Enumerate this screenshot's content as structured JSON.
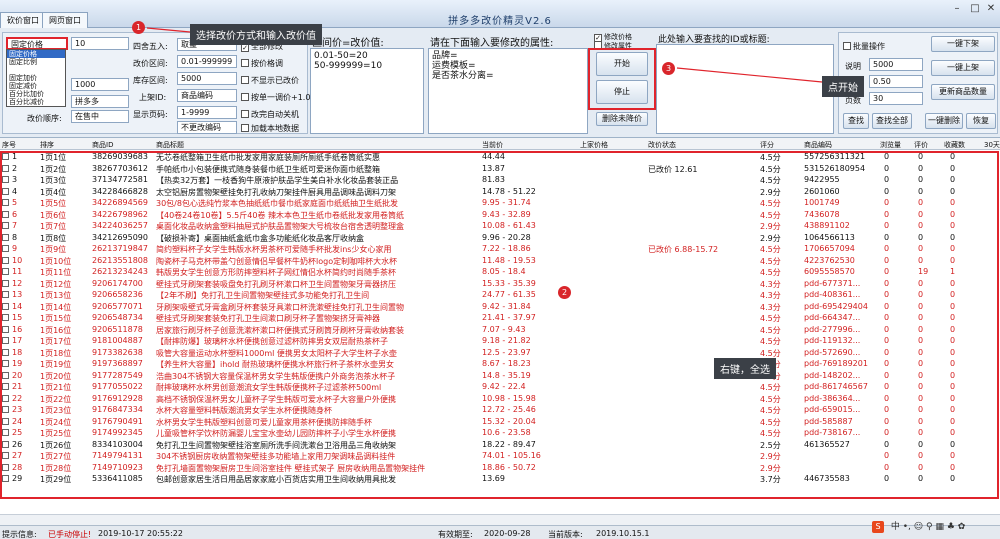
{
  "window": {
    "tabs": [
      "砍价窗口",
      "网页窗口"
    ],
    "title": "拼多多改价精灵V2.6"
  },
  "left_panel": {
    "mode_select": "固定价格",
    "mode_value": "10",
    "dropdown_options": [
      "固定价格",
      "固定比例",
      "",
      "固定加价",
      "固定减价",
      "百分比加价",
      "百分比减价"
    ],
    "labels": {
      "round": "四舍五入:",
      "range": "改价区间:",
      "stock": "库存区间:",
      "category": "上架ID:",
      "display": "显示页码:",
      "sort": "改价顺序:"
    },
    "values": {
      "round": "取整",
      "range": "0.01-999999",
      "stock": "5000",
      "category": "商品编码",
      "display": "1-9999",
      "display2": "不更改编码",
      "v_a": "1000",
      "v_b": "拼多多",
      "v_c": "在售中"
    },
    "checks": {
      "c1": "全部修改",
      "c2": "按价格调",
      "c3": "不显示已改价",
      "c4": "按单一调价+1.01",
      "c5": "改完自动关机",
      "c6": "加载本地数据"
    }
  },
  "price_box": {
    "label": "区间价=改价值:",
    "content": "0.01-50=20\n50-999999=10"
  },
  "attr_box": {
    "label": "请在下面输入要修改的属性:",
    "content": "品牌=\n运费模板=\n是否茶水分离="
  },
  "actions": {
    "modify_price": "修改价格",
    "modify_attr": "修改属性",
    "start": "开始",
    "stop": "停止",
    "clear": "删除未降价"
  },
  "search_box": {
    "label": "此处输入要查找的ID或标题:"
  },
  "right_panel": {
    "batch": "批量操作",
    "btn_download": "一键下架",
    "btn_upload": "一键上架",
    "btn_update": "更新商品数量",
    "btn_delete": "一键删除",
    "btn_find": "查找",
    "btn_findall": "查找全部",
    "btn_restore": "恢复",
    "tip_label": "说明",
    "tip_value": "5000",
    "tip_label2": "上架",
    "tip_value2": "0.50",
    "tip_label3": "页数",
    "tip_value3": "30"
  },
  "callouts": {
    "c1": "选择改价方式和输入改价值",
    "c2": "右键，全选",
    "c3": "点开始",
    "n1": "1",
    "n2": "2",
    "n3": "3"
  },
  "table": {
    "headers": [
      "序号",
      "排序",
      "商品ID",
      "商品标题",
      "当前价",
      "上家价格",
      "改价状态",
      "评分",
      "商品编码",
      "浏览量",
      "评价",
      "收藏数",
      "30天"
    ],
    "rows": [
      {
        "n": "1",
        "rank": "1页1位",
        "id": "38269039683",
        "title": "无芯卷纸整箱卫生纸巾批发家用家庭装厕所厕纸手纸卷筒纸实惠",
        "price": "44.44",
        "status": "",
        "score": "4.5分",
        "code": "557256311321",
        "views": "0",
        "rev": "0",
        "fav": "0",
        "red": false
      },
      {
        "n": "2",
        "rank": "1页2位",
        "id": "38267703612",
        "title": "手帕纸巾小包装便携式随身装餐巾纸卫生纸可爱迷你面巾纸整箱",
        "price": "13.87",
        "status": "已改价 12.61",
        "score": "4.5分",
        "code": "531526180954",
        "views": "0",
        "rev": "0",
        "fav": "0",
        "red": false
      },
      {
        "n": "3",
        "rank": "1页3位",
        "id": "37134772581",
        "title": "【热卖32万套】一枝香狗牛原液护肤品学生美白补水化妆品套装正品",
        "price": "81.83",
        "status": "",
        "score": "4.5分",
        "code": "9422955",
        "views": "0",
        "rev": "0",
        "fav": "0",
        "red": false
      },
      {
        "n": "4",
        "rank": "1页4位",
        "id": "34228466828",
        "title": "太空铝厨房置物架壁挂免打孔收纳刀架挂件厨具用品调味品调料刀架",
        "price": "14.78 - 51.22",
        "status": "",
        "score": "2.9分",
        "code": "2601060",
        "views": "0",
        "rev": "0",
        "fav": "0",
        "red": false
      },
      {
        "n": "5",
        "rank": "1页5位",
        "id": "34226894569",
        "title": "30包/8包心选纯竹浆本色抽纸纸巾餐巾纸家庭面巾纸纸抽卫生纸批发",
        "price": "9.95 - 31.74",
        "status": "",
        "score": "4.5分",
        "code": "1001749",
        "views": "0",
        "rev": "0",
        "fav": "0",
        "red": true
      },
      {
        "n": "6",
        "rank": "1页6位",
        "id": "34226798962",
        "title": "【40卷24卷10卷】5.5斤40卷 辣木本色卫生纸巾卷纸批发家用卷筒纸",
        "price": "9.43 - 32.89",
        "status": "",
        "score": "4.5分",
        "code": "7436078",
        "views": "0",
        "rev": "0",
        "fav": "0",
        "red": true
      },
      {
        "n": "7",
        "rank": "1页7位",
        "id": "34224036257",
        "title": "桌面化妆品收纳盒塑料抽屉式护肤品置物架大号梳妆台宿舍透明整理盒",
        "price": "10.08 - 61.43",
        "status": "",
        "score": "2.9分",
        "code": "438891102",
        "views": "0",
        "rev": "0",
        "fav": "0",
        "red": true
      },
      {
        "n": "8",
        "rank": "1页8位",
        "id": "34212695090",
        "title": "【破损补寄】桌面抽纸盒纸巾盒多功能纸化妆品客厅收纳盒",
        "price": "9.96 - 20.28",
        "status": "",
        "score": "2.9分",
        "code": "1064566113",
        "views": "0",
        "rev": "0",
        "fav": "0",
        "red": false
      },
      {
        "n": "9",
        "rank": "1页9位",
        "id": "26213719847",
        "title": "简约塑料杯子女学生韩版水杯男茶杯可爱随手杯批发ins少女心家用",
        "price": "7.22 - 18.86",
        "status": "已改价 6.88-15.72",
        "score": "4.5分",
        "code": "1706657094",
        "views": "0",
        "rev": "0",
        "fav": "0",
        "red": true
      },
      {
        "n": "10",
        "rank": "1页10位",
        "id": "26213551808",
        "title": "陶瓷杯子马克杯带盖勺创意情侣早餐杯牛奶杯logo定制咖啡杯大水杯",
        "price": "11.48 - 19.53",
        "status": "",
        "score": "4.5分",
        "code": "4223762530",
        "views": "0",
        "rev": "0",
        "fav": "0",
        "red": true
      },
      {
        "n": "11",
        "rank": "1页11位",
        "id": "26213234243",
        "title": "韩版男女学生创意方形防摔塑料杯子网红情侣水杯简约时尚随手茶杯",
        "price": "8.05 - 18.4",
        "status": "",
        "score": "4.5分",
        "code": "6095558570",
        "views": "0",
        "rev": "19",
        "fav": "1",
        "red": true
      },
      {
        "n": "12",
        "rank": "1页12位",
        "id": "9206174700",
        "title": "壁挂式牙刷架套装吸盘免打孔刷牙杯漱口杯卫生间置物架牙膏器挤压",
        "price": "15.33 - 35.39",
        "status": "",
        "score": "4.3分",
        "code": "pdd-677371...",
        "views": "0",
        "rev": "0",
        "fav": "0",
        "red": true
      },
      {
        "n": "13",
        "rank": "1页13位",
        "id": "9206658236",
        "title": "【2年不刷】免打孔卫生间置物架壁挂式多功能免打孔卫生间",
        "price": "24.77 - 61.35",
        "status": "",
        "score": "4.3分",
        "code": "pdd-408361...",
        "views": "0",
        "rev": "0",
        "fav": "0",
        "red": true
      },
      {
        "n": "14",
        "rank": "1页14位",
        "id": "9206577071",
        "title": "牙刷架吸壁式牙膏盒刷牙杯套装牙具漱口杯洗漱壁挂免打孔卫生间置物",
        "price": "9.42 - 31.84",
        "status": "",
        "score": "4.3分",
        "code": "pdd-695429404",
        "views": "0",
        "rev": "0",
        "fav": "0",
        "red": true
      },
      {
        "n": "15",
        "rank": "1页15位",
        "id": "9206548734",
        "title": "壁挂式牙刷架套装免打孔卫生间漱口刷牙杯子置物架挤牙膏神器",
        "price": "21.41 - 37.97",
        "status": "",
        "score": "4.5分",
        "code": "pdd-664347...",
        "views": "0",
        "rev": "0",
        "fav": "0",
        "red": true
      },
      {
        "n": "16",
        "rank": "1页16位",
        "id": "9206511878",
        "title": "居家旅行刷牙杯子创意洗漱杯漱口杯便携式牙刷筒牙刷杯牙膏收纳套装",
        "price": "7.07 - 9.43",
        "status": "",
        "score": "4.5分",
        "code": "pdd-277996...",
        "views": "0",
        "rev": "0",
        "fav": "0",
        "red": true
      },
      {
        "n": "17",
        "rank": "1页17位",
        "id": "9181004887",
        "title": "【耐摔防爆】玻璃杯水杯便携创意过滤杯防摔男女双层耐热茶杯子",
        "price": "9.18 - 21.82",
        "status": "",
        "score": "4.5分",
        "code": "pdd-119132...",
        "views": "0",
        "rev": "0",
        "fav": "0",
        "red": true
      },
      {
        "n": "18",
        "rank": "1页18位",
        "id": "9173382638",
        "title": "吸管大容量运动水杯塑料1000ml 便携男女太阳杯子大学生杯子水壶",
        "price": "12.5 - 23.97",
        "status": "",
        "score": "4.5分",
        "code": "pdd-572690...",
        "views": "0",
        "rev": "0",
        "fav": "0",
        "red": true
      },
      {
        "n": "19",
        "rank": "1页19位",
        "id": "9197368897",
        "title": "【养生杯大容量】ihold 耐热玻璃杯便携水杯旅行杯子茶杯水壶男女",
        "price": "8.67 - 18.23",
        "status": "",
        "score": "4.5分",
        "code": "pdd-769189201",
        "views": "0",
        "rev": "0",
        "fav": "0",
        "red": true
      },
      {
        "n": "20",
        "rank": "1页20位",
        "id": "9177287549",
        "title": "浩曲304不锈钢大容量保温杯男女学生韩版便携户外商务泡茶水杯子",
        "price": "14.8 - 35.19",
        "status": "",
        "score": "4.5分",
        "code": "pdd-148202...",
        "views": "0",
        "rev": "0",
        "fav": "0",
        "red": true
      },
      {
        "n": "21",
        "rank": "1页21位",
        "id": "9177055022",
        "title": "耐摔玻璃杯水杯男创意潮流女学生韩版便携杯子过滤茶杯500ml",
        "price": "9.42 - 22.4",
        "status": "",
        "score": "4.5分",
        "code": "pdd-861746567",
        "views": "0",
        "rev": "0",
        "fav": "0",
        "red": true
      },
      {
        "n": "22",
        "rank": "1页22位",
        "id": "9176912928",
        "title": "高档不锈钢保温杯男女儿童杯子学生韩版可爱水杯子大容量户外便携",
        "price": "10.98 - 15.98",
        "status": "",
        "score": "4.5分",
        "code": "pdd-386364...",
        "views": "0",
        "rev": "0",
        "fav": "0",
        "red": true
      },
      {
        "n": "23",
        "rank": "1页23位",
        "id": "9176847334",
        "title": "水杯大容量塑料韩版潮流男女学生水杯便携随身杯",
        "price": "12.72 - 25.46",
        "status": "",
        "score": "4.5分",
        "code": "pdd-659015...",
        "views": "0",
        "rev": "0",
        "fav": "0",
        "red": true
      },
      {
        "n": "24",
        "rank": "1页24位",
        "id": "9176790491",
        "title": "水杯男女学生韩版塑料创意可爱儿童家用茶杯便携防摔随手杯",
        "price": "15.32 - 20.04",
        "status": "",
        "score": "4.5分",
        "code": "pdd-585887",
        "views": "0",
        "rev": "0",
        "fav": "0",
        "red": true
      },
      {
        "n": "25",
        "rank": "1页25位",
        "id": "9174992345",
        "title": "儿童吸管杯学饮杯防漏婴儿宝宝水壶幼儿园防摔杯子小学生水杯便携",
        "price": "10.6 - 23.58",
        "status": "",
        "score": "4.5分",
        "code": "pdd-738167...",
        "views": "0",
        "rev": "0",
        "fav": "0",
        "red": true
      },
      {
        "n": "26",
        "rank": "1页26位",
        "id": "8334103004",
        "title": "免打孔卫生间置物架壁挂浴室厕所洗手间洗漱台卫浴用品三角收纳架",
        "price": "18.22 - 89.47",
        "status": "",
        "score": "2.5分",
        "code": "461365527",
        "views": "0",
        "rev": "0",
        "fav": "0",
        "red": false
      },
      {
        "n": "27",
        "rank": "1页27位",
        "id": "7149794131",
        "title": "304不锈钢厨房收纳置物架壁挂多功能墙上家用刀架调味品调料挂件",
        "price": "74.01 - 105.16",
        "status": "",
        "score": "2.9分",
        "code": "",
        "views": "0",
        "rev": "0",
        "fav": "0",
        "red": true
      },
      {
        "n": "28",
        "rank": "1页28位",
        "id": "7149710923",
        "title": "免打孔墙面置物架厨房卫生间浴室挂件 壁挂式架子 厨房收纳用品置物架挂件",
        "price": "18.86 - 50.72",
        "status": "",
        "score": "2.9分",
        "code": "",
        "views": "0",
        "rev": "0",
        "fav": "0",
        "red": true
      },
      {
        "n": "29",
        "rank": "1页29位",
        "id": "5336411085",
        "title": "包邮创意家居生活日用品居家家庭小百货店实用卫生间收纳用具批发",
        "price": "13.69",
        "status": "",
        "score": "3.7分",
        "code": "446735583",
        "views": "0",
        "rev": "0",
        "fav": "0",
        "red": false
      }
    ]
  },
  "status": {
    "tip_label": "提示信息:",
    "tip": "已手动停止!",
    "time": "2019-10-17 20:55:22",
    "valid_label": "有效期至:",
    "valid": "2020-09-28",
    "version_label": "当前版本:",
    "version": "2019.10.15.1"
  },
  "colors": {
    "accent_red": "#e0242c",
    "row_red": "#d21f1f",
    "callout_bg": "#3b4047"
  }
}
